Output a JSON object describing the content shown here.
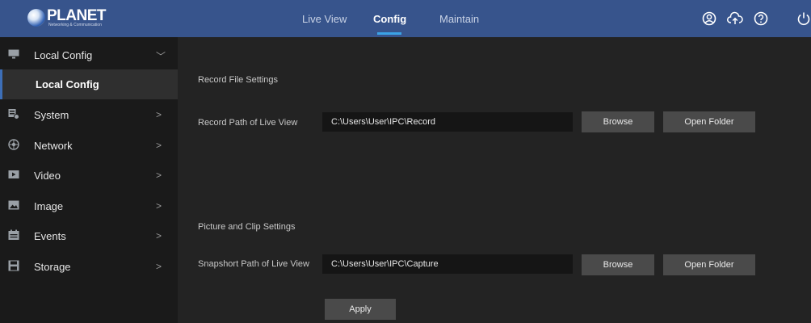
{
  "brand": {
    "name": "PLANET",
    "tagline": "Networking & Communication"
  },
  "nav": {
    "items": [
      {
        "label": "Live View"
      },
      {
        "label": "Config"
      },
      {
        "label": "Maintain"
      }
    ],
    "active": "Config"
  },
  "top_icons": [
    "user-icon",
    "cloud-upload-icon",
    "help-icon",
    "power-icon"
  ],
  "sidebar": {
    "items": [
      {
        "label": "Local Config",
        "icon": "monitor-icon",
        "chevron": "﹀"
      },
      {
        "label": "System",
        "icon": "system-icon",
        "chevron": ">"
      },
      {
        "label": "Network",
        "icon": "network-icon",
        "chevron": ">"
      },
      {
        "label": "Video",
        "icon": "video-icon",
        "chevron": ">"
      },
      {
        "label": "Image",
        "icon": "image-icon",
        "chevron": ">"
      },
      {
        "label": "Events",
        "icon": "events-icon",
        "chevron": ">"
      },
      {
        "label": "Storage",
        "icon": "storage-icon",
        "chevron": ">"
      }
    ],
    "sub_item": "Local Config"
  },
  "main": {
    "record_section_title": "Record File Settings",
    "record_label": "Record Path of Live View",
    "record_path": "C:\\Users\\User\\IPC\\Record",
    "picture_section_title": "Picture and Clip Settings",
    "snapshot_label": "Snapshort Path of Live View",
    "snapshot_path": "C:\\Users\\User\\IPC\\Capture",
    "browse_label": "Browse",
    "open_folder_label": "Open Folder",
    "apply_label": "Apply"
  },
  "colors": {
    "topbar": "#37548c",
    "sidebar": "#1a1a1a",
    "main_bg": "#232323",
    "accent": "#3ba3e6"
  }
}
